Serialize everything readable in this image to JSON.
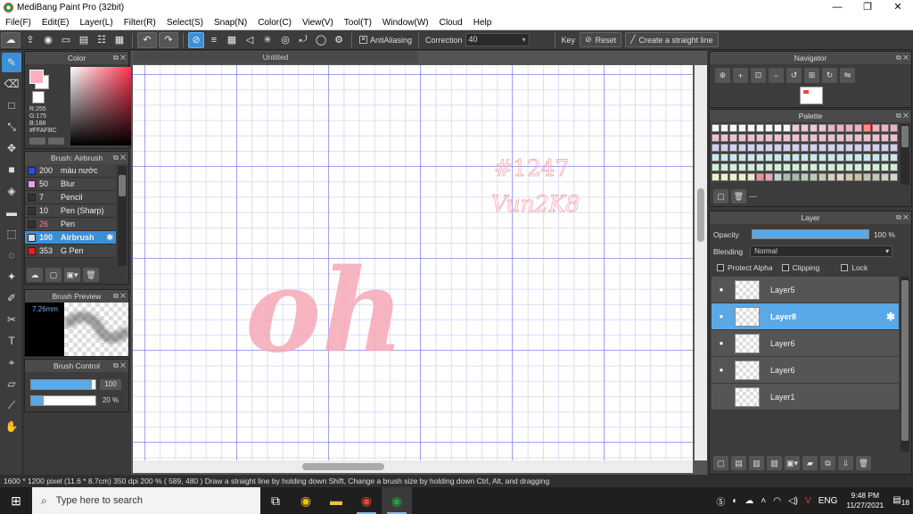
{
  "window": {
    "title": "MediBang Paint Pro (32bit)",
    "minimize": "—",
    "maximize": "❐",
    "close": "✕"
  },
  "menu": [
    "File(F)",
    "Edit(E)",
    "Layer(L)",
    "Filter(R)",
    "Select(S)",
    "Snap(N)",
    "Color(C)",
    "View(V)",
    "Tool(T)",
    "Window(W)",
    "Cloud",
    "Help"
  ],
  "toolbar": {
    "antialiasing_label": "AntiAliasing",
    "correction_label": "Correction",
    "correction_value": "40",
    "key_label": "Key",
    "reset_label": "Reset",
    "straight_line_label": "Create a straight line"
  },
  "color_panel": {
    "title": "Color",
    "rgb_text": "R:255\nG:175\nB:188\n#FFAFBC",
    "r": "R:255",
    "g": "G:175",
    "b": "B:188",
    "hex": "#FFAFBC",
    "main_color": "#ffafbc"
  },
  "brush_panel": {
    "title": "Brush: Airbrush",
    "items": [
      {
        "size": "200",
        "name": "màu nước",
        "color": "#2850d8"
      },
      {
        "size": "50",
        "name": "Blur",
        "color": "#e8a0e8"
      },
      {
        "size": "7",
        "name": "Pencil",
        "color": "#333333"
      },
      {
        "size": "10",
        "name": "Pen (Sharp)",
        "color": "#333333"
      },
      {
        "size": "26",
        "name": "Pen",
        "color": "#333333"
      },
      {
        "size": "100",
        "name": "Airbrush",
        "color": "#dddddd"
      },
      {
        "size": "353",
        "name": "G Pen",
        "color": "#e02020"
      }
    ]
  },
  "brush_preview": {
    "title": "Brush Preview",
    "size_text": "7.26mm"
  },
  "brush_control": {
    "title": "Brush Control",
    "size_value": "100",
    "opacity_value": "20 %",
    "size_fraction": 0.95,
    "opacity_fraction": 0.2
  },
  "canvas": {
    "tab_title": "Untitled",
    "sign_line1": "#1247",
    "sign_line2": "Vun2K8",
    "drawing_text": "oh"
  },
  "navigator": {
    "title": "Navigator"
  },
  "palette": {
    "title": "Palette",
    "name": "---",
    "colors": [
      "#f8f8f8",
      "#f8f8f8",
      "#f8f8f8",
      "#f8f8f8",
      "#f8f8f8",
      "#f8f8f8",
      "#f8f8f8",
      "#f8f8f8",
      "#f8f8f8",
      "#f0c8d0",
      "#f0c8d0",
      "#f0c8d0",
      "#f0c8d0",
      "#f0b0c0",
      "#f0b0c0",
      "#f0b0c0",
      "#f0b0c0",
      "#f09090",
      "#f0b0c0",
      "#f0b0c0",
      "#f0b0c0",
      "#f0c0d0",
      "#f0c0d0",
      "#f0c0d0",
      "#f0c0d0",
      "#f0c0d0",
      "#f0c0d0",
      "#f0c0d0",
      "#f0c0d0",
      "#f0c0d0",
      "#f0c0d0",
      "#f0c0d0",
      "#f0c0d0",
      "#f0c0d0",
      "#f0c0d0",
      "#f0c0d0",
      "#f0c0d0",
      "#f0c0d0",
      "#f0c0d0",
      "#f0c0d0",
      "#f0c0d0",
      "#f0c0d0",
      "#d0d0f0",
      "#d0d0f0",
      "#d0d0f0",
      "#d0d0f0",
      "#d0d0f0",
      "#d0d0f0",
      "#d0d0f0",
      "#d0d0f0",
      "#d0d0f0",
      "#d0d0f0",
      "#d0d0f0",
      "#d0d0f0",
      "#d0d0f0",
      "#d0d0f0",
      "#d0d0f0",
      "#d0d0f0",
      "#d0d0f0",
      "#d0d0f0",
      "#d0d0f0",
      "#d0d0f0",
      "#d0d0f0",
      "#c8e8f0",
      "#c8e8f0",
      "#c8e8f0",
      "#c8e8f0",
      "#c8e8f0",
      "#c8e8f0",
      "#c8e8f0",
      "#c8e8f0",
      "#c8e8f0",
      "#c8e8f0",
      "#c8e8f0",
      "#c8e8f0",
      "#c8e8f0",
      "#c8e8f0",
      "#c8e8f0",
      "#c8e8f0",
      "#c8e8f0",
      "#c8e8f0",
      "#c8e8f0",
      "#c8e8f0",
      "#c8e8f0",
      "#d0f0d8",
      "#d0f0d8",
      "#d0f0d8",
      "#d0f0d8",
      "#d0f0d8",
      "#d0f0d8",
      "#d0f0d8",
      "#d0f0d8",
      "#d0f0d8",
      "#d0f0d8",
      "#d0f0d8",
      "#d0f0d8",
      "#d0f0d8",
      "#d0f0d8",
      "#d0f0d8",
      "#d0f0d8",
      "#d0f0d8",
      "#d0f0d8",
      "#d0f0d8",
      "#d0f0d8",
      "#d0f0d8",
      "#f0f0c8",
      "#f0f0c8",
      "#f0f0c8",
      "#f0f0c8",
      "#f0e8d0",
      "#f09090",
      "#e8a8b8",
      "#c0d8c8",
      "#a8c0b0",
      "#a8b8a8",
      "#c0c8c0",
      "#b8d0b0",
      "#c8c8b8",
      "#d8d0b8",
      "#e0d8c0",
      "#d8c8a8",
      "#c8c0a0",
      "#c8c0a8",
      "#c8c8b0",
      "#d0d0c0",
      "#d8d8c8"
    ]
  },
  "layer_panel": {
    "title": "Layer",
    "opacity_label": "Opacity",
    "opacity_value": "100 %",
    "opacity_fraction": 1.0,
    "blending_label": "Blending",
    "blending_value": "Normal",
    "protect_alpha": "Protect Alpha",
    "clipping": "Clipping",
    "lock": "Lock",
    "layers": [
      {
        "name": "Layer5",
        "visible": true,
        "active": false
      },
      {
        "name": "Layer8",
        "visible": true,
        "active": true
      },
      {
        "name": "Layer6",
        "visible": true,
        "active": false
      },
      {
        "name": "Layer6",
        "visible": true,
        "active": false
      },
      {
        "name": "Layer1",
        "visible": false,
        "active": false
      }
    ]
  },
  "status": {
    "text": "1600 * 1200 pixel   (11.6 * 8.7cm)   350 dpi   200 %   ( 589, 480 )   Draw a straight line by holding down Shift, Change a brush size by holding down Ctrl, Alt, and dragging"
  },
  "taskbar": {
    "search_placeholder": "Type here to search",
    "language": "ENG",
    "time": "9:48 PM",
    "date": "11/27/2021",
    "notification_count": "18"
  }
}
